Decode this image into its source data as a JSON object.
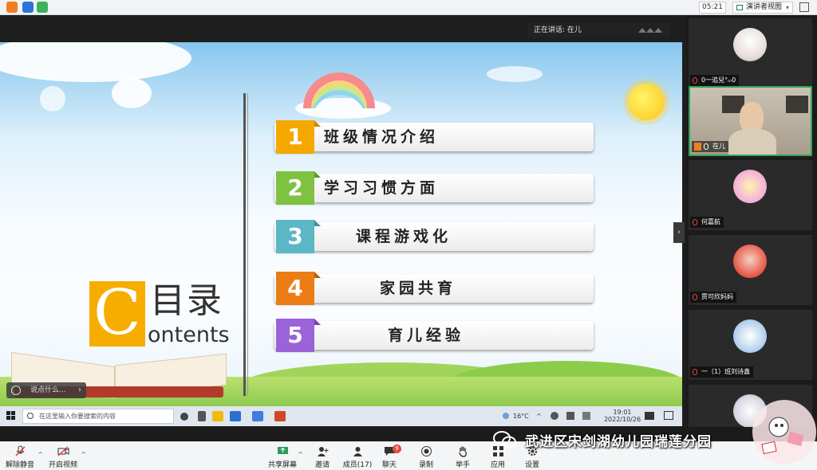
{
  "topbar": {
    "time": "05:21",
    "view_label": "演讲者视图"
  },
  "stage": {
    "speaking_label": "正在讲话: 在儿"
  },
  "slide": {
    "c_letter": "C",
    "heading": "目录",
    "subheading": "ontents",
    "items": [
      {
        "number": "1",
        "label": "班级情况介绍",
        "color": "#f5a800"
      },
      {
        "number": "2",
        "label": "学习习惯方面",
        "color": "#7fc241"
      },
      {
        "number": "3",
        "label": "课程游戏化",
        "color": "#5bb7c6"
      },
      {
        "number": "4",
        "label": "家园共育",
        "color": "#ec7c16"
      },
      {
        "number": "5",
        "label": "育儿经验",
        "color": "#9a63d8"
      }
    ],
    "chat_placeholder": "说点什么..."
  },
  "taskbar": {
    "search_placeholder": "在这里输入你要搜索的内容",
    "weather": "16°C",
    "clock_time": "19:01",
    "clock_date": "2022/10/26"
  },
  "gallery": {
    "participants": [
      {
        "name": "0一追兒°ₘ0",
        "avatar": "#e9dede"
      },
      {
        "name": "在儿",
        "avatar": "#d9c8b3",
        "active": true
      },
      {
        "name": "何嘉航",
        "avatar": "#f5b7d7"
      },
      {
        "name": "贾可欣妈妈",
        "avatar": "#e85b4c"
      },
      {
        "name": "一（1）班刘诗鑫",
        "avatar": "#b9d4ee"
      },
      {
        "name": "",
        "avatar": "#d9d9e4"
      }
    ]
  },
  "toolbar": {
    "mute": "解除静音",
    "video": "开启视频",
    "share": "共享屏幕",
    "invite": "邀请",
    "members": "成员(17)",
    "chat": "聊天",
    "chat_badge": "9",
    "record": "录制",
    "raise_hand": "举手",
    "apps": "应用",
    "settings": "设置"
  },
  "watermark": {
    "text": "武进区宋剑湖幼儿园瑞莲分园"
  }
}
